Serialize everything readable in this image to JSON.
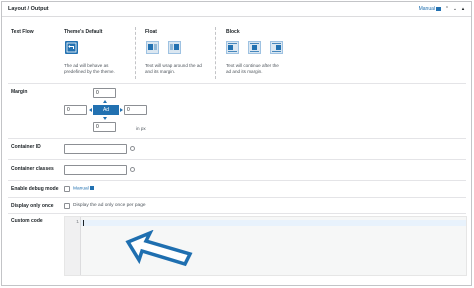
{
  "header": {
    "title": "Layout / Output",
    "manual_label": "Manual"
  },
  "text_flow": {
    "label": "Text Flow",
    "options": [
      {
        "title": "Theme's Default",
        "desc_line1": "The ad will behave as",
        "desc_line2": "predefined by the theme."
      },
      {
        "title": "Float",
        "desc_line1": "Text will wrap around the ad",
        "desc_line2": "and its margin."
      },
      {
        "title": "Block",
        "desc_line1": "Text will continue after the",
        "desc_line2": "ad and its margin."
      }
    ]
  },
  "margin": {
    "label": "Margin",
    "top": "0",
    "left": "0",
    "right": "0",
    "bottom": "0",
    "ad_label": "Ad",
    "unit": "in px"
  },
  "container_id": {
    "label": "Container ID",
    "value": ""
  },
  "container_classes": {
    "label": "Container classes",
    "value": ""
  },
  "debug_mode": {
    "label": "Enable debug mode",
    "manual_label": "Manual"
  },
  "display_once": {
    "label": "Display only once",
    "checkbox_label": "Display the ad only once per page"
  },
  "custom_code": {
    "label": "Custom code",
    "line_number": "1"
  },
  "colors": {
    "accent": "#2271b1",
    "icon_light": "#dbe7f1",
    "editor_bg": "#f6f7f7",
    "arrow": "#1f6fb0"
  }
}
